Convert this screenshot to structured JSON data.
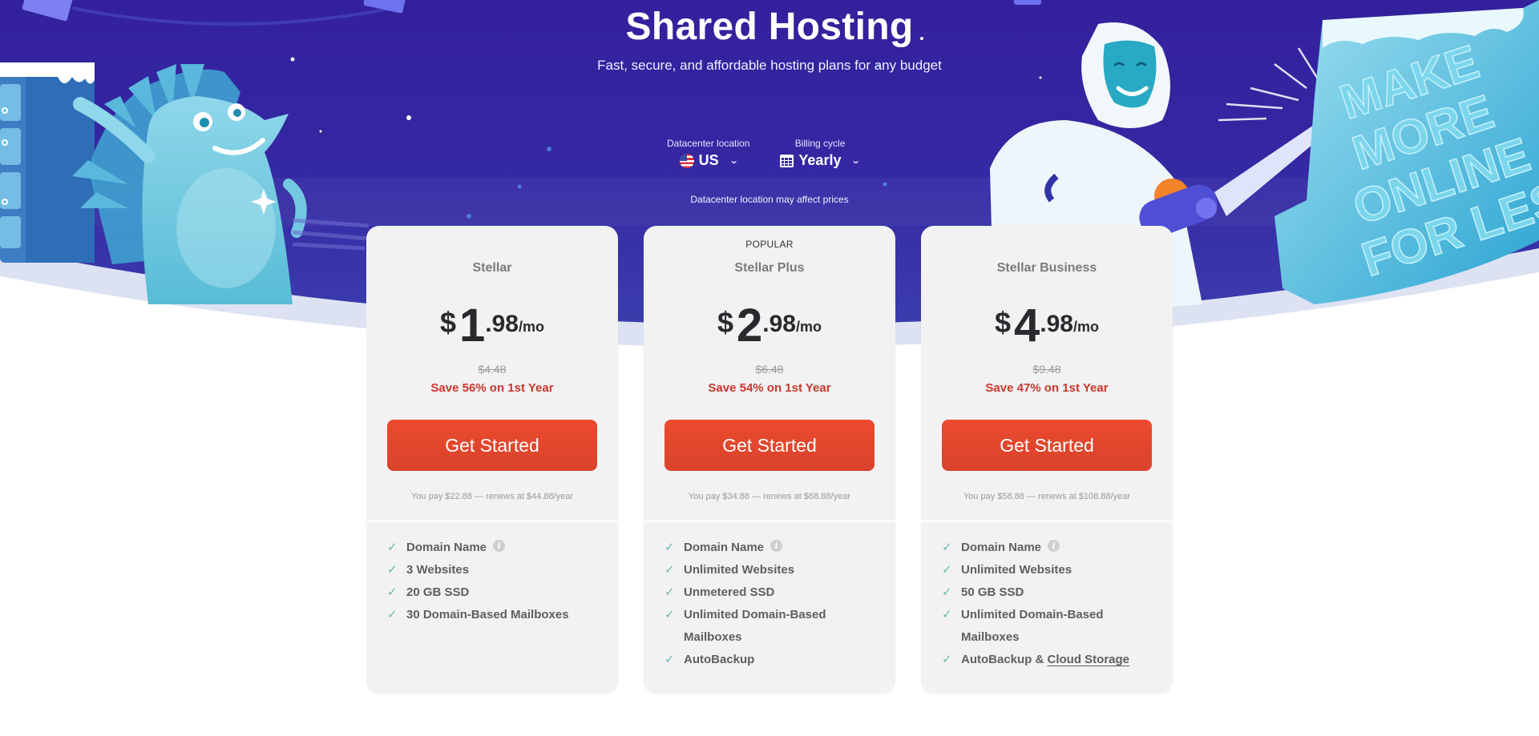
{
  "hero": {
    "title": "Shared Hosting",
    "subtitle": "Fast, secure, and affordable hosting plans for any budget",
    "promo_art_text": "MAKE MORE ONLINE FOR LESS",
    "colors": {
      "bg_top": "#33239e",
      "bg_bottom": "#3d3aa8",
      "snow": "#dde2f3"
    }
  },
  "selectors": {
    "datacenter": {
      "label": "Datacenter location",
      "value": "US",
      "icon": "us-flag-icon"
    },
    "billing": {
      "label": "Billing cycle",
      "value": "Yearly",
      "icon": "calendar-icon"
    },
    "note": "Datacenter location may affect prices"
  },
  "plans": [
    {
      "badge": "",
      "name": "Stellar",
      "currency": "$",
      "price_int": "1",
      "price_dec": ".98",
      "period": "/mo",
      "old_price": "$4.48",
      "save": "Save 56% on 1st Year",
      "cta": "Get Started",
      "renew": "You pay $22.88 — renews at $44.88/year",
      "features": [
        {
          "text": "Domain Name",
          "info": true
        },
        {
          "text": "3 Websites"
        },
        {
          "text": "20 GB SSD"
        },
        {
          "text": "30 Domain-Based Mailboxes"
        }
      ]
    },
    {
      "badge": "POPULAR",
      "name": "Stellar Plus",
      "currency": "$",
      "price_int": "2",
      "price_dec": ".98",
      "period": "/mo",
      "old_price": "$6.48",
      "save": "Save 54% on 1st Year",
      "cta": "Get Started",
      "renew": "You pay $34.88 — renews at $68.88/year",
      "features": [
        {
          "text": "Domain Name",
          "info": true
        },
        {
          "text": "Unlimited Websites"
        },
        {
          "text": "Unmetered SSD"
        },
        {
          "text": "Unlimited Domain-Based Mailboxes"
        },
        {
          "text": "AutoBackup"
        }
      ]
    },
    {
      "badge": "",
      "name": "Stellar Business",
      "currency": "$",
      "price_int": "4",
      "price_dec": ".98",
      "period": "/mo",
      "old_price": "$9.48",
      "save": "Save 47% on 1st Year",
      "cta": "Get Started",
      "renew": "You pay $58.88 — renews at $108.88/year",
      "features": [
        {
          "text": "Domain Name",
          "info": true
        },
        {
          "text": "Unlimited Websites"
        },
        {
          "text": "50 GB SSD"
        },
        {
          "text": "Unlimited Domain-Based Mailboxes"
        },
        {
          "text": "AutoBackup & ",
          "link": "Cloud Storage"
        }
      ]
    }
  ],
  "colors": {
    "cta": "#e4472d",
    "save": "#c9372c",
    "check": "#6cb8ad",
    "card_bg": "#f2f2f3"
  }
}
